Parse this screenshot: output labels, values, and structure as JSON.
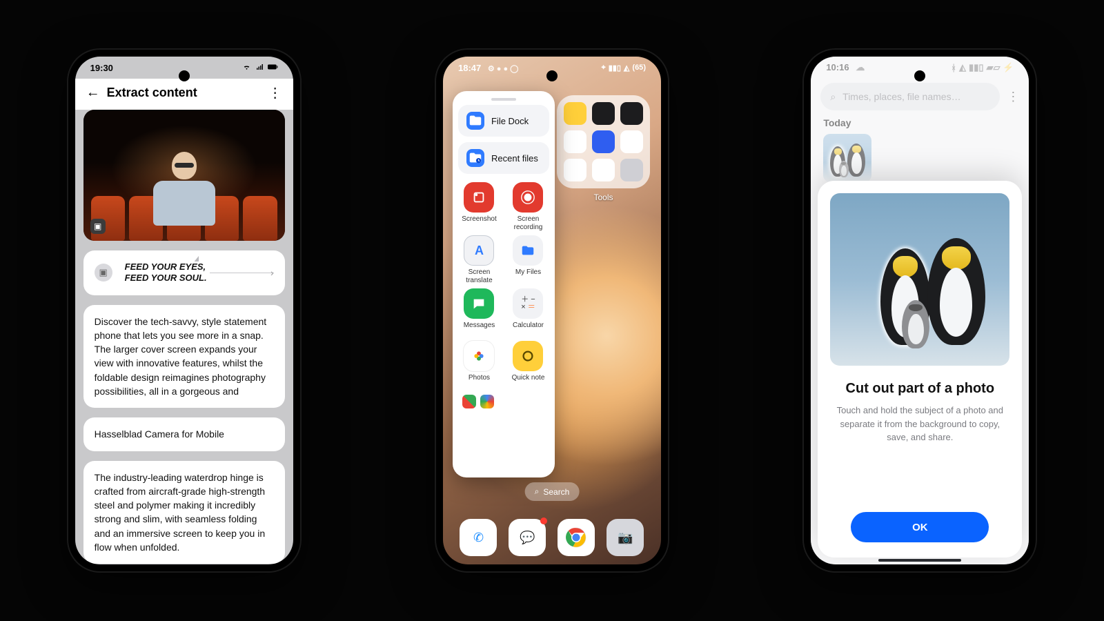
{
  "phone1": {
    "status_time": "19:30",
    "appbar": {
      "title": "Extract content"
    },
    "slogan": {
      "line1": "FEED YOUR EYES,",
      "line2": "FEED YOUR SOUL."
    },
    "cards": {
      "desc": "Discover the tech-savvy, style statement phone that lets you see more in a snap. The larger cover screen expands your view with innovative features, whilst the foldable design reimagines photography possibilities, all in a gorgeous and",
      "hasselblad": "Hasselblad Camera for Mobile",
      "hinge": "The industry-leading waterdrop hinge is crafted from aircraft-grade high-strength steel and polymer making it incredibly strong and slim, with seamless folding and an immersive screen to keep you in flow when unfolded."
    }
  },
  "phone2": {
    "status_time": "18:47",
    "battery_pct": "65",
    "assistant": {
      "file_dock": "File Dock",
      "recent_files": "Recent files",
      "items": [
        {
          "id": "screenshot",
          "label": "Screenshot",
          "style": "red"
        },
        {
          "id": "screen-recording",
          "label": "Screen recording",
          "style": "red"
        },
        {
          "id": "screen-translate",
          "label": "Screen translate",
          "style": "wht"
        },
        {
          "id": "my-files",
          "label": "My Files",
          "style": "wht"
        },
        {
          "id": "messages",
          "label": "Messages",
          "style": "grn"
        },
        {
          "id": "calculator",
          "label": "Calculator",
          "style": "wht"
        },
        {
          "id": "photos",
          "label": "Photos",
          "style": "photos"
        },
        {
          "id": "quick-note",
          "label": "Quick note",
          "style": "yel"
        }
      ]
    },
    "tools_folder": {
      "label": "Tools"
    },
    "search_label": "Search",
    "dock": [
      "phone",
      "messages",
      "chrome",
      "camera"
    ]
  },
  "phone3": {
    "status_time": "10:16",
    "search_placeholder": "Times, places, file names…",
    "section": "Today",
    "sheet": {
      "title": "Cut out part of a photo",
      "desc": "Touch and hold the subject of a photo and separate it from the background to copy, save, and share.",
      "ok": "OK"
    }
  }
}
